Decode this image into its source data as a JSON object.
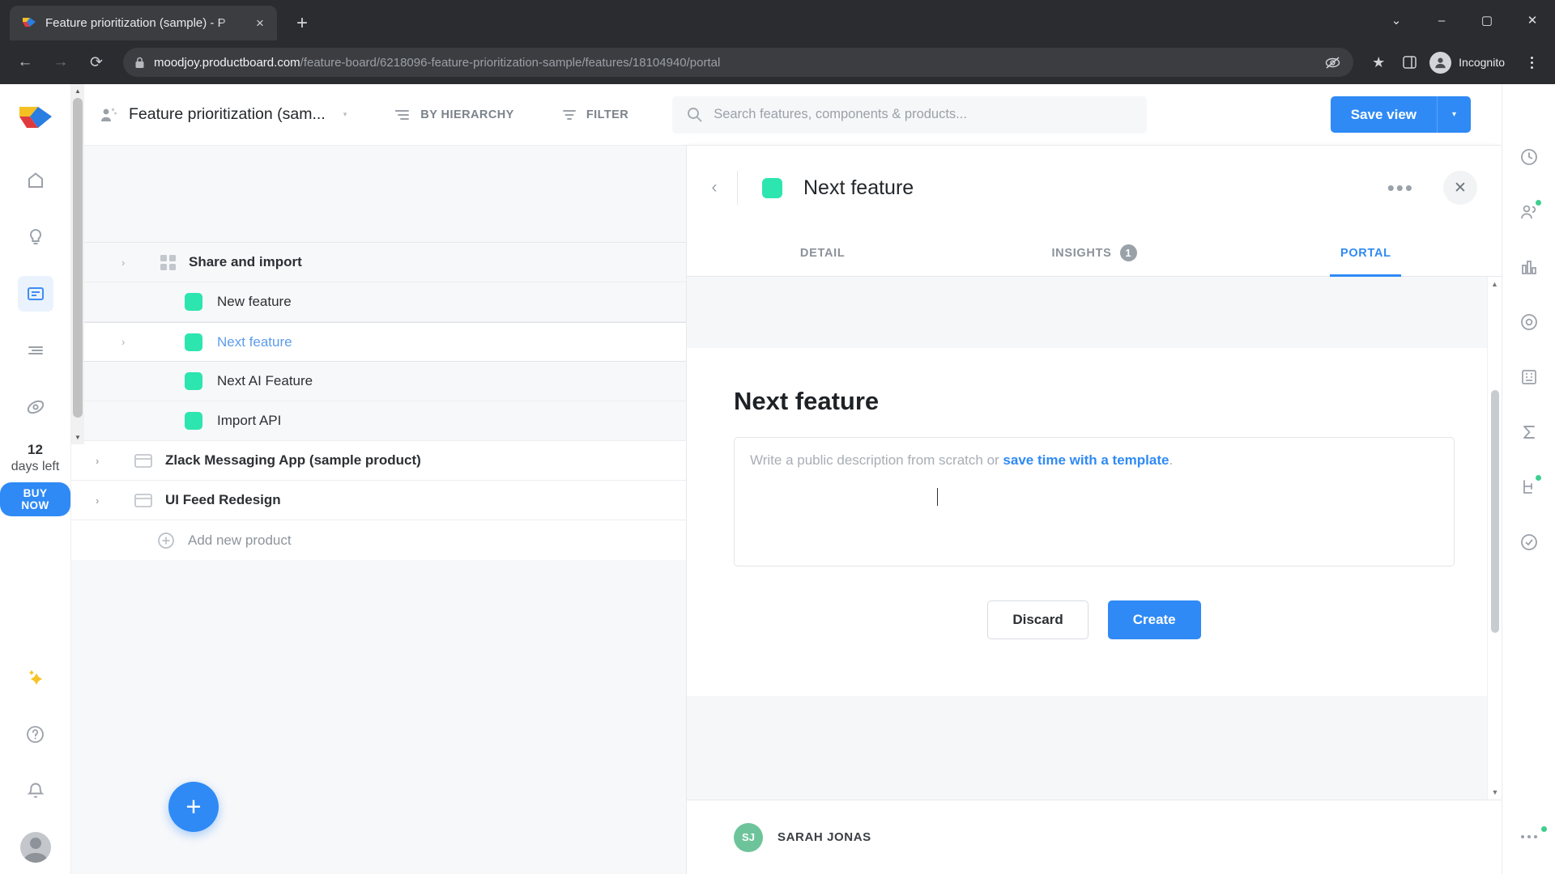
{
  "browser": {
    "tab": {
      "title": "Feature prioritization (sample) - P",
      "favicon": "productboard-logo-icon",
      "close": "×"
    },
    "new_tab": "+",
    "window_controls": {
      "minimize_chevron": "⌄",
      "minimize": "–",
      "maximize": "▢",
      "close": "✕"
    },
    "nav": {
      "back": "←",
      "forward": "→",
      "reload": "⟳"
    },
    "omnibox": {
      "lock_icon": "lock-icon",
      "host": "moodjoy.productboard.com",
      "path": "/feature-board/6218096-feature-prioritization-sample/features/18104940/portal"
    },
    "omni_actions": {
      "no_tracking": "tracking-protection-icon",
      "bookmark": "★",
      "side_panel": "▯"
    },
    "profile": {
      "label": "Incognito"
    },
    "menu": "browser-menu-icon"
  },
  "rail": {
    "logo": "productboard-logo",
    "items": [
      {
        "name": "home",
        "icon": "home-icon",
        "active": false
      },
      {
        "name": "insights",
        "icon": "lightbulb-icon",
        "active": false
      },
      {
        "name": "features",
        "icon": "features-board-icon",
        "active": true
      },
      {
        "name": "roadmap",
        "icon": "roadmap-lines-icon",
        "active": false
      },
      {
        "name": "portal",
        "icon": "portal-eye-icon",
        "active": false
      }
    ],
    "trial": {
      "days": "12",
      "label": "days left",
      "cta": "BUY NOW"
    },
    "bottom": [
      {
        "name": "ai-sparkles",
        "icon": "sparkles-icon"
      },
      {
        "name": "help",
        "icon": "question-circle-icon"
      },
      {
        "name": "notifications",
        "icon": "bell-icon"
      }
    ],
    "avatar": "user-avatar"
  },
  "appbar": {
    "board_icon": "board-people-icon",
    "board_title": "Feature prioritization (sam...",
    "board_caret": "▾",
    "by_hierarchy": {
      "label": "BY HIERARCHY",
      "icon": "hierarchy-icon"
    },
    "filter": {
      "label": "FILTER",
      "icon": "filter-icon"
    },
    "search": {
      "placeholder": "Search features, components & products...",
      "icon": "search-icon"
    },
    "save_view": {
      "label": "Save view",
      "caret": "▾"
    }
  },
  "tree": {
    "rows": [
      {
        "label": "Share and import",
        "type": "component",
        "chevron": "›",
        "icon": "grid-icon",
        "selected": false
      },
      {
        "label": "New feature",
        "type": "feature",
        "chevron": "",
        "swatch": "#2de5ae",
        "selected": false
      },
      {
        "label": "Next feature",
        "type": "feature",
        "chevron": "›",
        "swatch": "#2de5ae",
        "selected": true
      },
      {
        "label": "Next AI Feature",
        "type": "feature",
        "chevron": "",
        "swatch": "#2de5ae",
        "selected": false
      },
      {
        "label": "Import API",
        "type": "feature",
        "chevron": "",
        "swatch": "#2de5ae",
        "selected": false
      },
      {
        "label": "Zlack Messaging App (sample product)",
        "type": "product",
        "chevron": "›",
        "icon": "product-icon",
        "selected": false
      },
      {
        "label": "UI Feed Redesign",
        "type": "product",
        "chevron": "›",
        "icon": "product-icon",
        "selected": false
      },
      {
        "label": "Add new product",
        "type": "add",
        "icon": "plus-circle-icon",
        "selected": false
      }
    ],
    "fab": "+"
  },
  "detail": {
    "back": "‹",
    "swatch_color": "#2de5ae",
    "title": "Next feature",
    "more": "•••",
    "close": "✕",
    "tabs": [
      {
        "label": "DETAIL",
        "badge": "",
        "active": false
      },
      {
        "label": "INSIGHTS",
        "badge": "1",
        "active": false
      },
      {
        "label": "PORTAL",
        "badge": "",
        "active": true
      }
    ],
    "portal": {
      "heading": "Next feature",
      "description_placeholder_prefix": "Write a public description from scratch or ",
      "description_placeholder_link": "save time with a template",
      "description_placeholder_suffix": ".",
      "discard_label": "Discard",
      "create_label": "Create"
    },
    "author": {
      "initials": "SJ",
      "name": "SARAH JONAS"
    }
  },
  "right_rail": {
    "items": [
      {
        "name": "history",
        "icon": "clock-icon",
        "dot": false
      },
      {
        "name": "people",
        "icon": "people-icon",
        "dot": true
      },
      {
        "name": "charts",
        "icon": "bar-chart-icon",
        "dot": false
      },
      {
        "name": "objectives",
        "icon": "target-icon",
        "dot": false
      },
      {
        "name": "company",
        "icon": "building-icon",
        "dot": false
      },
      {
        "name": "score",
        "icon": "sigma-icon",
        "dot": false
      },
      {
        "name": "dependencies",
        "icon": "branch-icon",
        "dot": true
      },
      {
        "name": "status",
        "icon": "check-circle-icon",
        "dot": false
      },
      {
        "name": "more",
        "icon": "more-dots-icon",
        "dot": true
      }
    ]
  },
  "colors": {
    "accent_blue": "#2f8af5",
    "feature_green": "#2de5ae",
    "panel_bg": "#f7f8fa",
    "chrome_dark": "#2b2c30"
  }
}
